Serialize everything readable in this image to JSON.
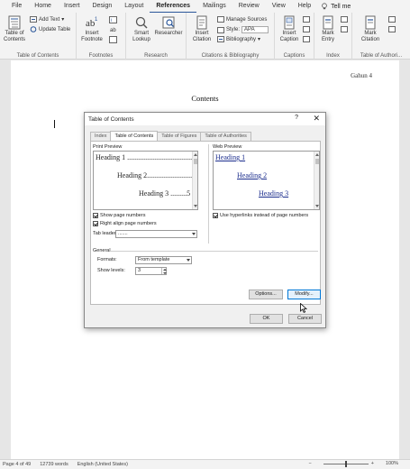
{
  "menu": {
    "tabs": [
      "File",
      "Home",
      "Insert",
      "Design",
      "Layout",
      "References",
      "Mailings",
      "Review",
      "View",
      "Help"
    ],
    "active": "References",
    "tell_me": "Tell me"
  },
  "ribbon": {
    "toc": {
      "label_1": "Table of",
      "label_2": "Contents",
      "add_text": "Add Text",
      "update_table": "Update Table",
      "group": "Table of Contents"
    },
    "footnotes": {
      "insert_1": "Insert",
      "insert_2": "Footnote",
      "group": "Footnotes"
    },
    "research": {
      "smart_1": "Smart",
      "smart_2": "Lookup",
      "researcher": "Researcher",
      "group": "Research"
    },
    "citations": {
      "insert_1": "Insert",
      "insert_2": "Citation",
      "manage": "Manage Sources",
      "style_label": "Style:",
      "style_value": "APA",
      "bibliography": "Bibliography",
      "group": "Citations & Bibliography"
    },
    "captions": {
      "insert_1": "Insert",
      "insert_2": "Caption",
      "group": "Captions"
    },
    "index": {
      "mark_1": "Mark",
      "mark_2": "Entry",
      "group": "Index"
    },
    "authorities": {
      "mark_1": "Mark",
      "mark_2": "Citation",
      "group": "Table of Authori..."
    }
  },
  "document": {
    "header": "Gahun 4",
    "heading": "Contents"
  },
  "dialog": {
    "title": "Table of Contents",
    "help": "?",
    "close": "✕",
    "tabs": [
      "Index",
      "Table of Contents",
      "Table of Figures",
      "Table of Authorities"
    ],
    "active_tab": "Table of Contents",
    "print_preview": {
      "label": "Print Preview",
      "lines": [
        {
          "text": "Heading 1 .....................................1"
        },
        {
          "text": "Heading 2.............................3"
        },
        {
          "text": "Heading 3 .........5"
        }
      ]
    },
    "web_preview": {
      "label": "Web Preview",
      "lines": [
        "Heading 1",
        "Heading 2",
        "Heading 3"
      ]
    },
    "show_page_numbers": "Show page numbers",
    "right_align": "Right align page numbers",
    "tab_leader_label": "Tab leader:",
    "tab_leader_value": ".......",
    "use_hyperlinks": "Use hyperlinks instead of page numbers",
    "general_label": "General",
    "formats_label": "Formats:",
    "formats_value": "From template",
    "show_levels_label": "Show levels:",
    "show_levels_value": "3",
    "options_button": "Options...",
    "modify_button": "Modify...",
    "ok_button": "OK",
    "cancel_button": "Cancel"
  },
  "status": {
    "page": "Page 4 of 49",
    "words": "12739 words",
    "language": "English (United States)",
    "zoom": "100%"
  }
}
